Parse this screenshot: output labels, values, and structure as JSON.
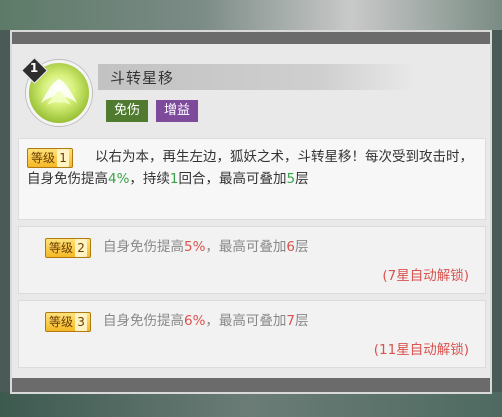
{
  "skill": {
    "level_number": "1",
    "title": "斗转星移",
    "tags": [
      "免伤",
      "增益"
    ]
  },
  "levels": [
    {
      "badge_text": "等级",
      "badge_num": "1",
      "desc_parts": [
        "以右为本，再生左边，狐妖之术，斗转星移！每次受到攻击时，自身免伤提高",
        "4%",
        "，持续",
        "1",
        "回合，最高可叠加",
        "5",
        "层"
      ],
      "unlocked": true
    },
    {
      "badge_text": "等级",
      "badge_num": "2",
      "desc_parts": [
        "自身免伤提高",
        "5%",
        "，最高可叠加",
        "6",
        "层"
      ],
      "unlock_text": "(7星自动解锁)",
      "unlocked": false
    },
    {
      "badge_text": "等级",
      "badge_num": "3",
      "desc_parts": [
        "自身免伤提高",
        "6%",
        "，最高可叠加",
        "7",
        "层"
      ],
      "unlock_text": "(11星自动解锁)",
      "unlocked": false
    }
  ],
  "colors": {
    "highlight_active": "#3aa34a",
    "highlight_locked": "#d9534f",
    "tag_green": "#4f7a30",
    "tag_purple": "#7d4a9c"
  },
  "icons": {
    "skill_icon": "fox-skill-icon"
  }
}
